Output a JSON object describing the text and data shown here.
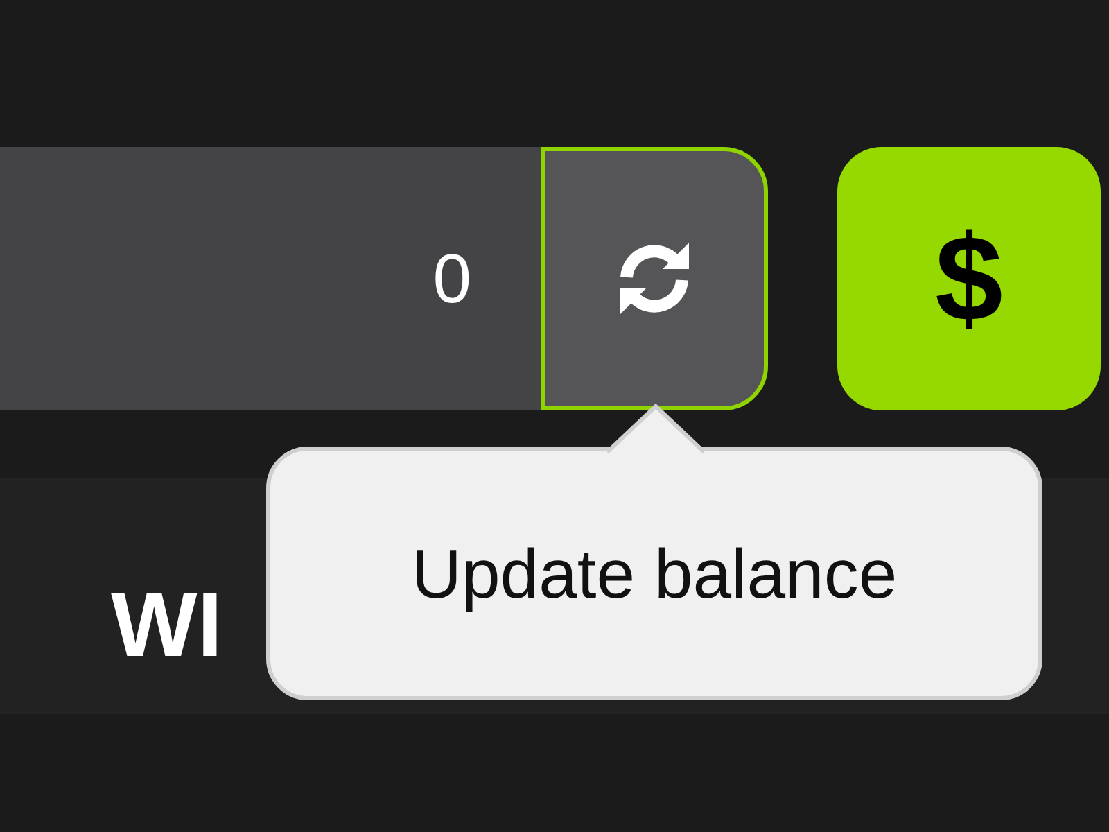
{
  "balance": {
    "value": "0"
  },
  "refresh_button": {
    "tooltip": "Update balance"
  },
  "deposit_button": {
    "label": "$"
  },
  "band": {
    "text_left": "WI"
  }
}
